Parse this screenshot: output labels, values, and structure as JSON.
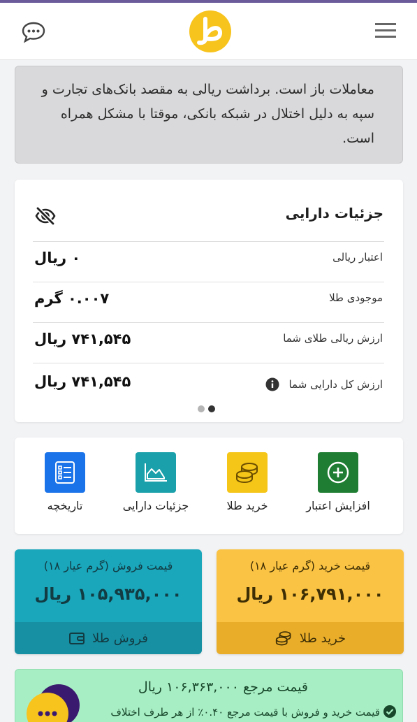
{
  "colors": {
    "logo_yellow": "#f7c31d",
    "increase_green": "#1e7d32",
    "buy_gold_tile": "#f5c518",
    "details_teal": "#1aa0aa",
    "history_blue": "#1a73e8",
    "sell_card": "#1aa6bb",
    "buy_card": "#fbc343",
    "reference_bg": "#a8eec4"
  },
  "header": {
    "chat_icon": "chat-bubble-icon",
    "logo_icon": "logo-icon",
    "menu_icon": "hamburger-menu-icon"
  },
  "notice": {
    "text": "معاملات باز است. برداشت ریالی به مقصد بانک‌های تجارت و سپه به دلیل اختلال در شبکه بانکی، موقتا با مشکل همراه است."
  },
  "assets": {
    "title": "جزئیات دارایی",
    "hide_icon": "eye-slash-icon",
    "rows": [
      {
        "label": "اعتبار ریالی",
        "value": "۰ ریال"
      },
      {
        "label": "موجودی طلا",
        "value": "۰.۰۰۷ گرم"
      },
      {
        "label": "ارزش ریالی طلای شما",
        "value": "۷۴۱,۵۴۵ ریال"
      },
      {
        "label": "ارزش کل دارایی شما",
        "value": "۷۴۱,۵۴۵ ریال"
      }
    ],
    "slide_total": 2,
    "slide_active": 2
  },
  "actions": [
    {
      "label": "افزایش اعتبار",
      "icon": "plus-circle-icon"
    },
    {
      "label": "خرید طلا",
      "icon": "coins-icon"
    },
    {
      "label": "جزئیات دارایی",
      "icon": "area-chart-icon"
    },
    {
      "label": "تاریخچه",
      "icon": "checklist-icon"
    }
  ],
  "sell": {
    "title": "قیمت فروش (گرم عیار ۱۸)",
    "value": "۱۰۵,۹۳۵,۰۰۰ ریال",
    "button": "فروش طلا",
    "button_icon": "wallet-icon"
  },
  "buy": {
    "title": "قیمت خرید (گرم عیار ۱۸)",
    "value": "۱۰۶,۷۹۱,۰۰۰ ریال",
    "button": "خرید طلا",
    "button_icon": "coins-icon"
  },
  "reference": {
    "title": "قیمت مرجع ۱۰۶,۳۶۳,۰۰۰ ریال",
    "note": "قیمت خرید و فروش با قیمت مرجع ۰.۴۰٪ از هر طرف اختلاف"
  }
}
